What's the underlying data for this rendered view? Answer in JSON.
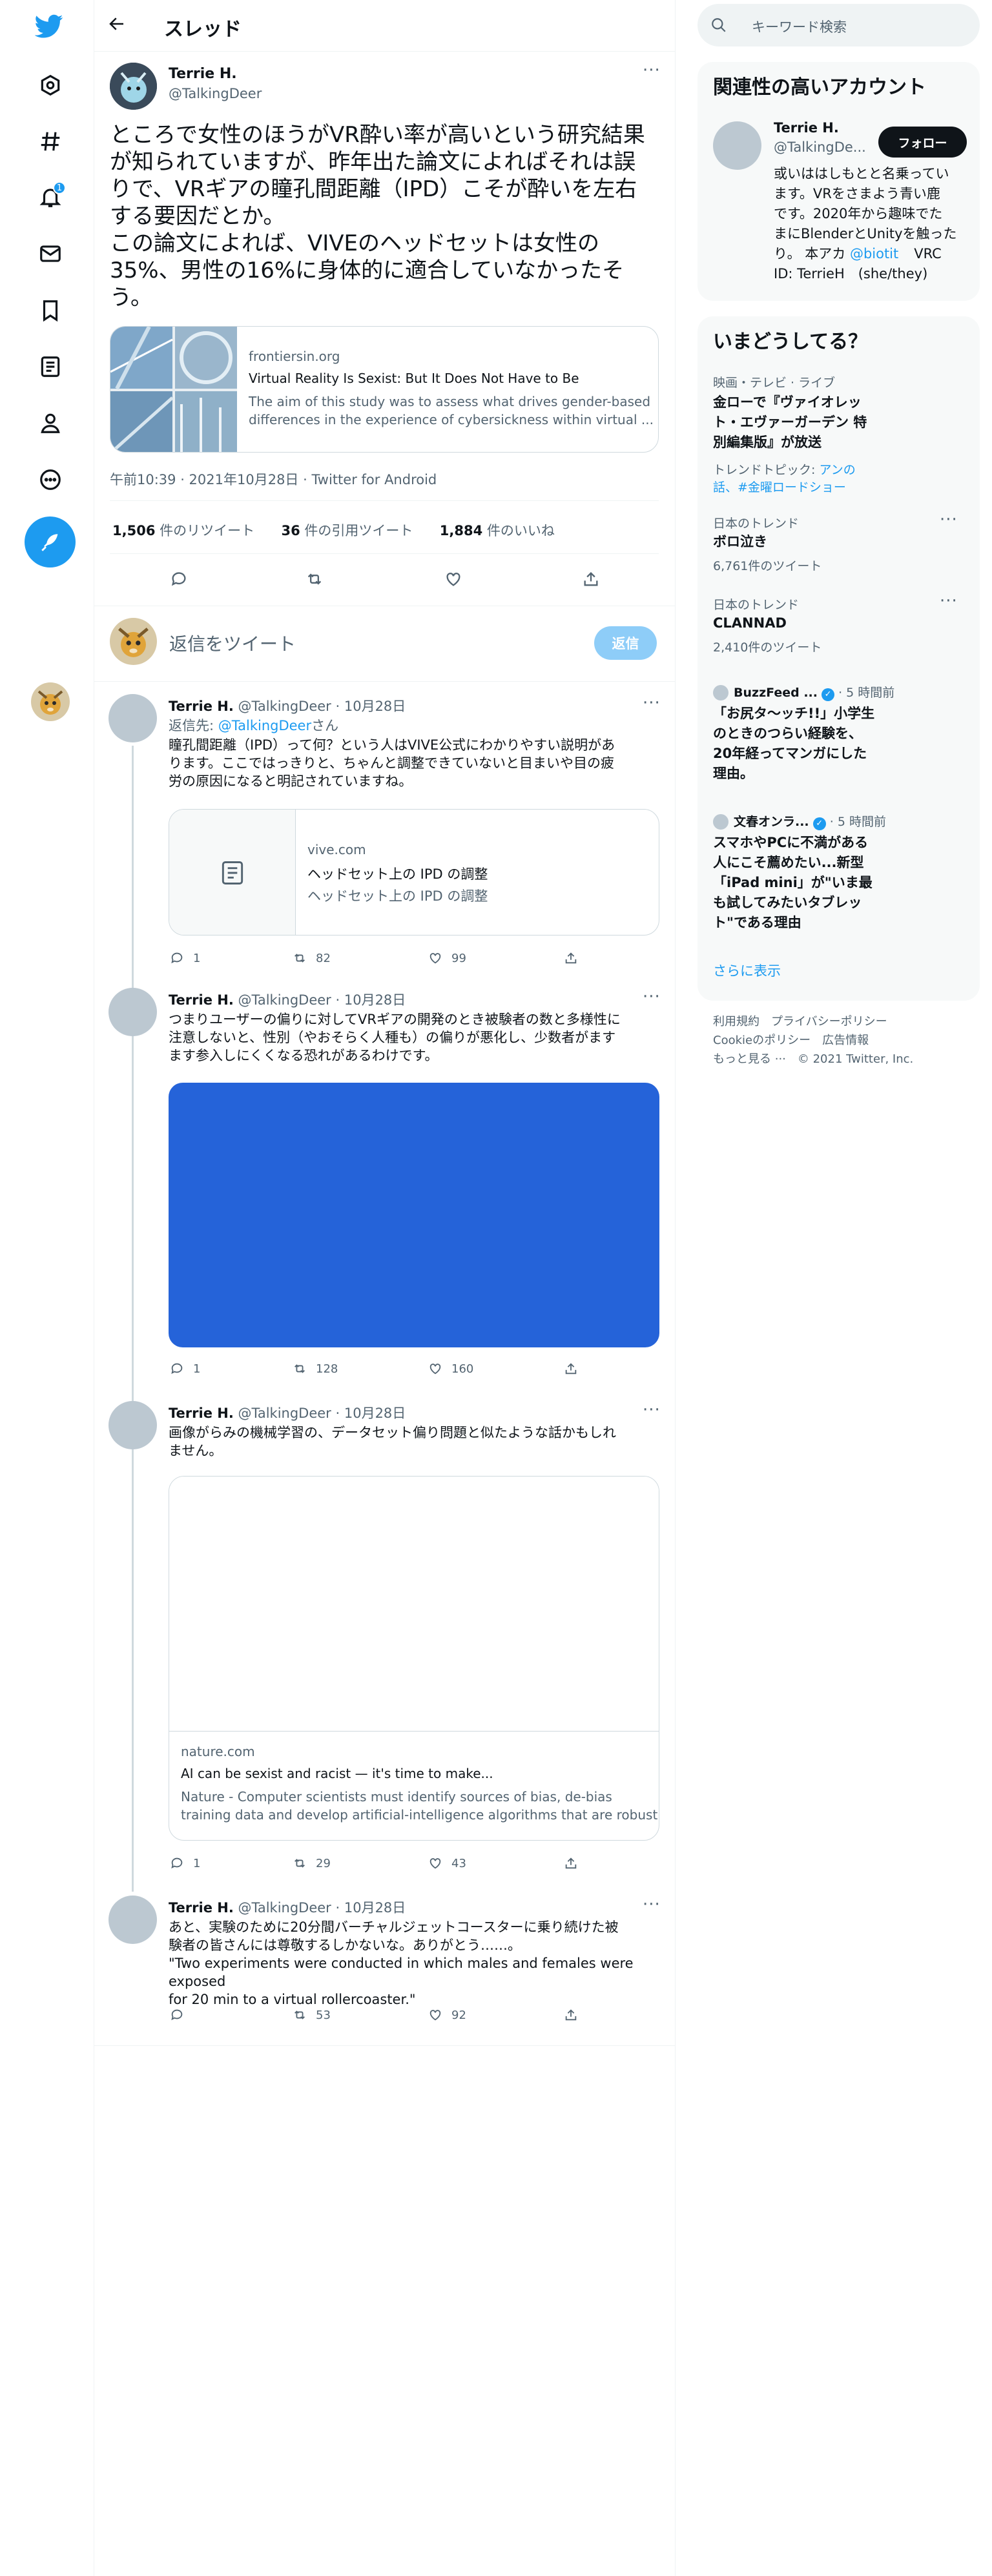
{
  "header": {
    "title": "スレッド"
  },
  "search": {
    "placeholder": "キーワード検索"
  },
  "nav": {
    "notification_badge": "1"
  },
  "main_tweet": {
    "name": "Terrie H.",
    "handle": "@TalkingDeer",
    "text_lines": [
      "ところで女性のほうがVR酔い率が高いという研究結果",
      "が知られていますが、昨年出た論文によればそれは誤",
      "りで、VRギアの瞳孔間距離（IPD）こそが酔いを左右",
      "する要因だとか。",
      "この論文によれば、VIVEのヘッドセットは女性の",
      "35%、男性の16%に身体的に適合していなかったそ",
      "う。"
    ],
    "card": {
      "domain": "frontiersin.org",
      "title": "Virtual Reality Is Sexist: But It Does Not Have to Be",
      "desc_lines": [
        "The aim of this study was to assess what drives gender-based",
        "differences in the experience of cybersickness within virtual ..."
      ]
    },
    "timestamp": "午前10:39 · 2021年10月28日 · Twitter for Android",
    "retweets": "1,506",
    "retweets_label": "件のリツイート",
    "quotes": "36",
    "quotes_label": "件の引用ツイート",
    "likes": "1,884",
    "likes_label": "件のいいね"
  },
  "reply_box": {
    "placeholder": "返信をツイート",
    "button": "返信"
  },
  "replies": [
    {
      "name": "Terrie H.",
      "meta": "@TalkingDeer · 10月28日",
      "replying_prefix": "返信先: ",
      "replying_handle": "@TalkingDeer",
      "replying_suffix": "さん",
      "text_lines": [
        "瞳孔間距離（IPD）って何？という人はVIVE公式にわかりやすい説明があ",
        "ります。ここではっきりと、ちゃんと調整できていないと目まいや目の疲",
        "労の原因になると明記されていますね。"
      ],
      "card": {
        "domain": "vive.com",
        "title": "ヘッドセット上の IPD の調整",
        "desc": "ヘッドセット上の IPD の調整"
      },
      "reply_count": "1",
      "retweet_count": "82",
      "like_count": "99"
    },
    {
      "name": "Terrie H.",
      "meta": "@TalkingDeer · 10月28日",
      "text_lines": [
        "つまりユーザーの偏りに対してVRギアの開発のとき被験者の数と多様性に",
        "注意しないと、性別（やおそらく人種も）の偏りが悪化し、少数者がます",
        "ます参入しにくくなる恐れがあるわけです。"
      ],
      "image_color": "#2563d9",
      "reply_count": "1",
      "retweet_count": "128",
      "like_count": "160"
    },
    {
      "name": "Terrie H.",
      "meta": "@TalkingDeer · 10月28日",
      "text_lines": [
        "画像がらみの機械学習の、データセット偏り問題と似たような話かもしれ",
        "ません。"
      ],
      "card": {
        "domain": "nature.com",
        "title": "AI can be sexist and racist — it's time to make...",
        "desc_lines": [
          "Nature - Computer scientists must identify sources of bias, de-bias",
          "training data and develop artificial-intelligence algorithms that are robust..."
        ]
      },
      "reply_count": "1",
      "retweet_count": "29",
      "like_count": "43"
    },
    {
      "name": "Terrie H.",
      "meta": "@TalkingDeer · 10月28日",
      "text_lines": [
        "あと、実験のために20分間バーチャルジェットコースターに乗り続けた被",
        "験者の皆さんには尊敬するしかないな。ありがとう……。",
        "\"Two experiments were conducted in which males and females were exposed",
        "for 20 min to a virtual rollercoaster.\""
      ],
      "reply_count": "",
      "retweet_count": "53",
      "like_count": "92"
    }
  ],
  "sidebar": {
    "related_title": "関連性の高いアカウント",
    "account": {
      "name": "Terrie H.",
      "handle": "@TalkingDe...",
      "follow": "フォロー",
      "bio_lines": [
        "或いははしもとと名乗ってい",
        "ます。VRをさまよう青い鹿",
        "です。2020年から趣味でた",
        "まにBlenderとUnityを触った",
        "り。 本アカ "
      ],
      "bio_link": "@biotit",
      "bio_tail": "VRC",
      "bio_last": "ID: TerrieH　(she/they)"
    },
    "trends_title": "いまどうしてる？",
    "trends": [
      {
        "category": "映画・テレビ · ライブ",
        "title_lines": [
          "金ローで『ヴァイオレッ",
          "ト・エヴァーガーデン 特",
          "別編集版』が放送"
        ],
        "topic_prefix": "トレンドトピック: ",
        "topic_lines": [
          "アンの",
          "話、#金曜ロードショー"
        ]
      },
      {
        "category": "日本のトレンド",
        "title": "ボロ泣き",
        "count": "6,761件のツイート"
      },
      {
        "category": "日本のトレンド",
        "title": "CLANNAD",
        "count": "2,410件のツイート"
      },
      {
        "source": "BuzzFeed ...",
        "time": "· 5 時間前",
        "title_lines": [
          "「お尻タ〜ッチ!!」小学生",
          "のときのつらい経験を、",
          "20年経ってマンガにした",
          "理由。"
        ]
      },
      {
        "source": "文春オンラ...",
        "time": "· 5 時間前",
        "title_lines": [
          "スマホやPCに不満がある",
          "人にこそ薦めたい...新型",
          "「iPad mini」が\"いま最",
          "も試してみたいタブレッ",
          "ト\"である理由"
        ]
      }
    ],
    "show_more": "さらに表示",
    "footer_lines": [
      "利用規約　プライバシーポリシー",
      "Cookieのポリシー　広告情報",
      "もっと見る ···　© 2021 Twitter, Inc."
    ]
  },
  "colors": {
    "accent": "#1d9bf0",
    "dark": "#0f1419",
    "gray": "#536471",
    "image_blue": "#2563d9"
  }
}
